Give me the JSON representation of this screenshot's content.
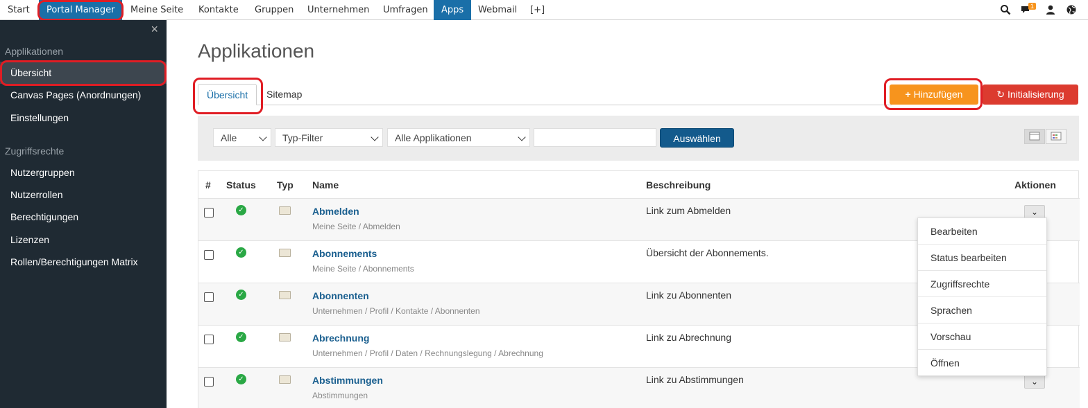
{
  "topnav": {
    "items": [
      "Start",
      "Portal Manager",
      "Meine Seite",
      "Kontakte",
      "Gruppen",
      "Unternehmen",
      "Umfragen",
      "Apps",
      "Webmail",
      "[+]"
    ],
    "notification_count": "1"
  },
  "sidebar": {
    "close": "×",
    "section1": "Applikationen",
    "items1": [
      "Übersicht",
      "Canvas Pages (Anordnungen)",
      "Einstellungen"
    ],
    "section2": "Zugriffsrechte",
    "items2": [
      "Nutzergruppen",
      "Nutzerrollen",
      "Berechtigungen",
      "Lizenzen",
      "Rollen/Berechtigungen Matrix"
    ]
  },
  "main": {
    "title": "Applikationen",
    "tabs": [
      "Übersicht",
      "Sitemap"
    ],
    "add_button": "Hinzufügen",
    "init_button": "Initialisierung"
  },
  "filters": {
    "status": "Alle",
    "type": "Typ-Filter",
    "apps": "Alle Applikationen",
    "text_value": "",
    "submit": "Auswählen"
  },
  "table": {
    "headers": [
      "#",
      "Status",
      "Typ",
      "Name",
      "Beschreibung",
      "Aktionen"
    ],
    "rows": [
      {
        "name": "Abmelden",
        "path": "Meine Seite / Abmelden",
        "desc": "Link zum Abmelden"
      },
      {
        "name": "Abonnements",
        "path": "Meine Seite / Abonnements",
        "desc": "Übersicht der Abonnements."
      },
      {
        "name": "Abonnenten",
        "path": "Unternehmen / Profil / Kontakte / Abonnenten",
        "desc": "Link zu Abonnenten"
      },
      {
        "name": "Abrechnung",
        "path": "Unternehmen / Profil / Daten / Rechnungslegung / Abrechnung",
        "desc": "Link zu Abrechnung"
      },
      {
        "name": "Abstimmungen",
        "path": "Abstimmungen",
        "desc": "Link zu Abstimmungen"
      }
    ]
  },
  "actions_menu": [
    "Bearbeiten",
    "Status bearbeiten",
    "Zugriffsrechte",
    "Sprachen",
    "Vorschau",
    "Öffnen"
  ],
  "colors": {
    "nav_active": "#1a6fa8",
    "add": "#f7941d",
    "init": "#dc3b2f",
    "highlight_ring": "#e01d24",
    "sidebar": "#1f2a33"
  }
}
